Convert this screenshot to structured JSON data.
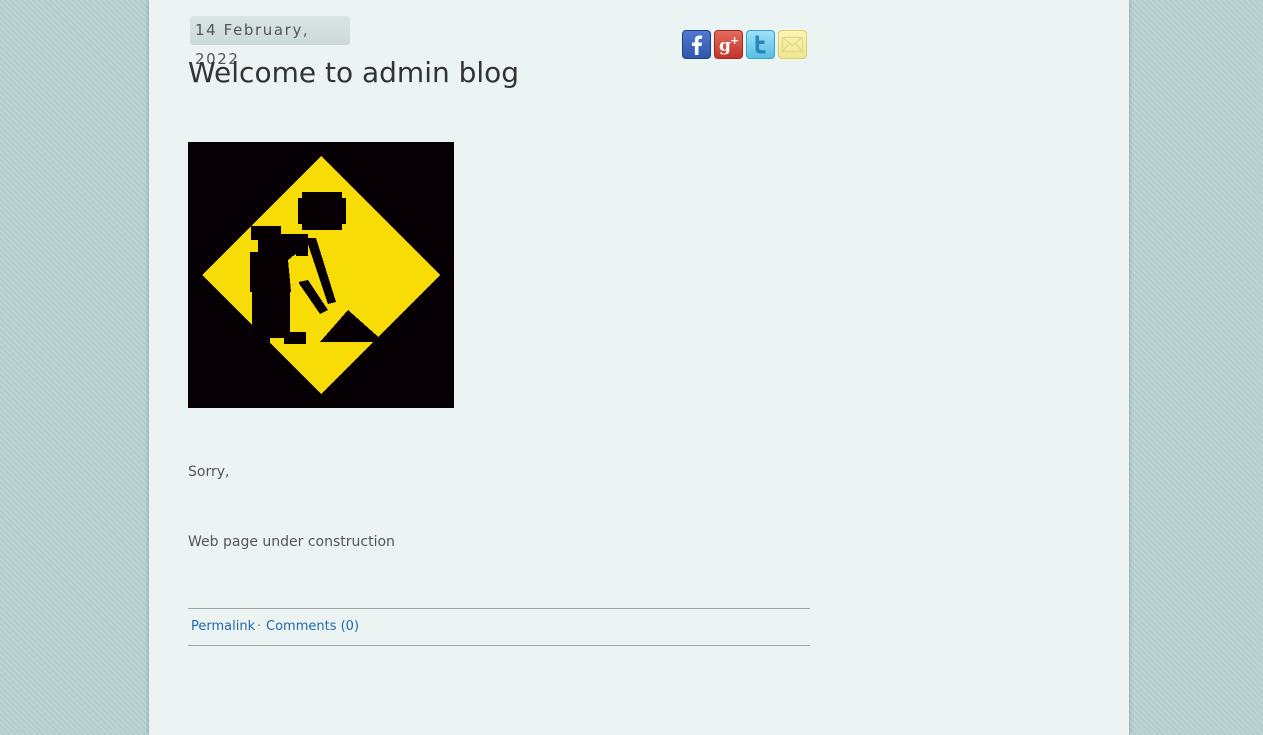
{
  "post": {
    "date": "14 February, 2022",
    "title": "Welcome to admin blog",
    "image_description_icon": "under-construction-sign",
    "paragraphs": [
      "Sorry,",
      "Web page under construction"
    ],
    "permalink_label": "Permalink",
    "separator": "·",
    "comments_label": "Comments (0)"
  },
  "share": [
    {
      "name": "facebook-icon",
      "color": "#3b5998"
    },
    {
      "name": "google-plus-icon",
      "color": "#d34836"
    },
    {
      "name": "twitter-icon",
      "color": "#55acee"
    },
    {
      "name": "email-icon",
      "color": "#f3ea9e"
    }
  ],
  "colors": {
    "background": "#b9d3d2",
    "page": "#ecf4f3",
    "link": "#2266aa",
    "sign_yellow": "#f8dc05"
  }
}
